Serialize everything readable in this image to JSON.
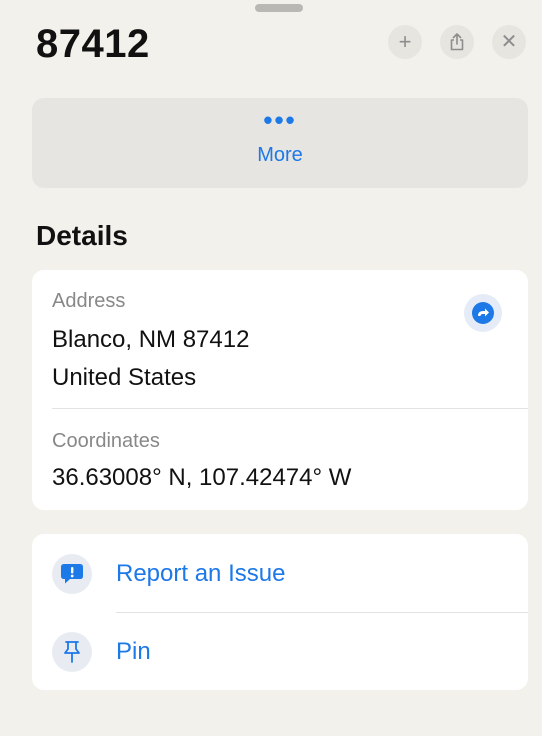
{
  "header": {
    "title": "87412",
    "add_icon": "plus-icon",
    "share_icon": "share-icon",
    "close_icon": "close-icon"
  },
  "more": {
    "dots": "•••",
    "label": "More"
  },
  "details": {
    "section_title": "Details",
    "address_label": "Address",
    "address_line1": "Blanco, NM  87412",
    "address_line2": "United States",
    "coordinates_label": "Coordinates",
    "coordinates_value": "36.63008° N, 107.42474° W",
    "directions_icon": "directions-arrow-icon"
  },
  "actions": [
    {
      "label": "Report an Issue",
      "icon": "report-issue-icon"
    },
    {
      "label": "Pin",
      "icon": "pin-icon"
    }
  ],
  "colors": {
    "accent": "#1d78e8",
    "background": "#f2f1ec",
    "card": "#ffffff"
  }
}
